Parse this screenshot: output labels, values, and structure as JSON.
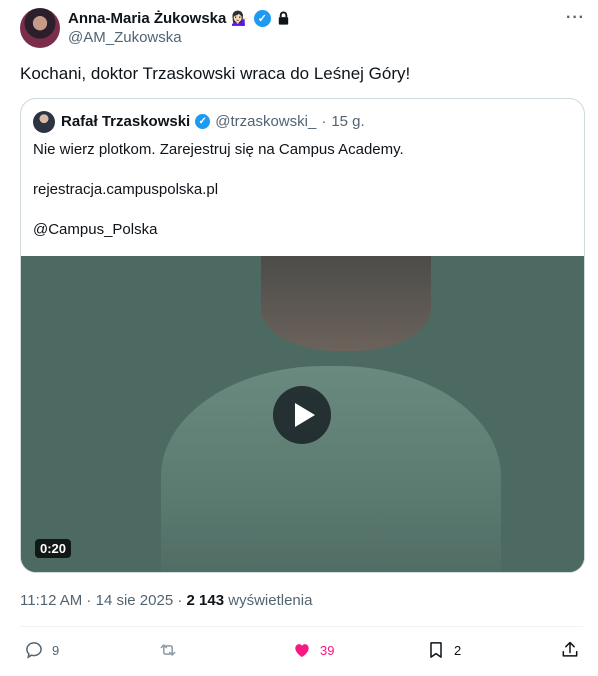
{
  "author": {
    "name": "Anna-Maria Żukowska",
    "emoji": "💁🏻‍♀️",
    "handle": "@AM_Zukowska"
  },
  "tweet": {
    "text": "Kochani, doktor Trzaskowski wraca do Leśnej Góry!"
  },
  "quote": {
    "name": "Rafał Trzaskowski",
    "handle": "@trzaskowski_",
    "separator": "·",
    "time": "15 g.",
    "line1": "Nie wierz plotkom. Zarejestruj się na Campus Academy.",
    "line2": "rejestracja.campuspolska.pl",
    "line3": "@Campus_Polska",
    "video_duration": "0:20"
  },
  "meta": {
    "time": "11:12 AM",
    "sep1": " · ",
    "date": "14 sie 2025",
    "sep2": " · ",
    "views_count": "2 143",
    "views_label": " wyświetlenia"
  },
  "actions": {
    "reply_count": "9",
    "repost_count": "",
    "like_count": "39",
    "bookmark_count": "2"
  },
  "colors": {
    "verified": "#1d9bf0",
    "like": "#f91880",
    "secondary": "#536471"
  },
  "icons": [
    "verified-icon",
    "lock-icon",
    "more-icon",
    "play-icon",
    "reply-icon",
    "repost-icon",
    "like-icon",
    "bookmark-icon",
    "share-icon"
  ]
}
